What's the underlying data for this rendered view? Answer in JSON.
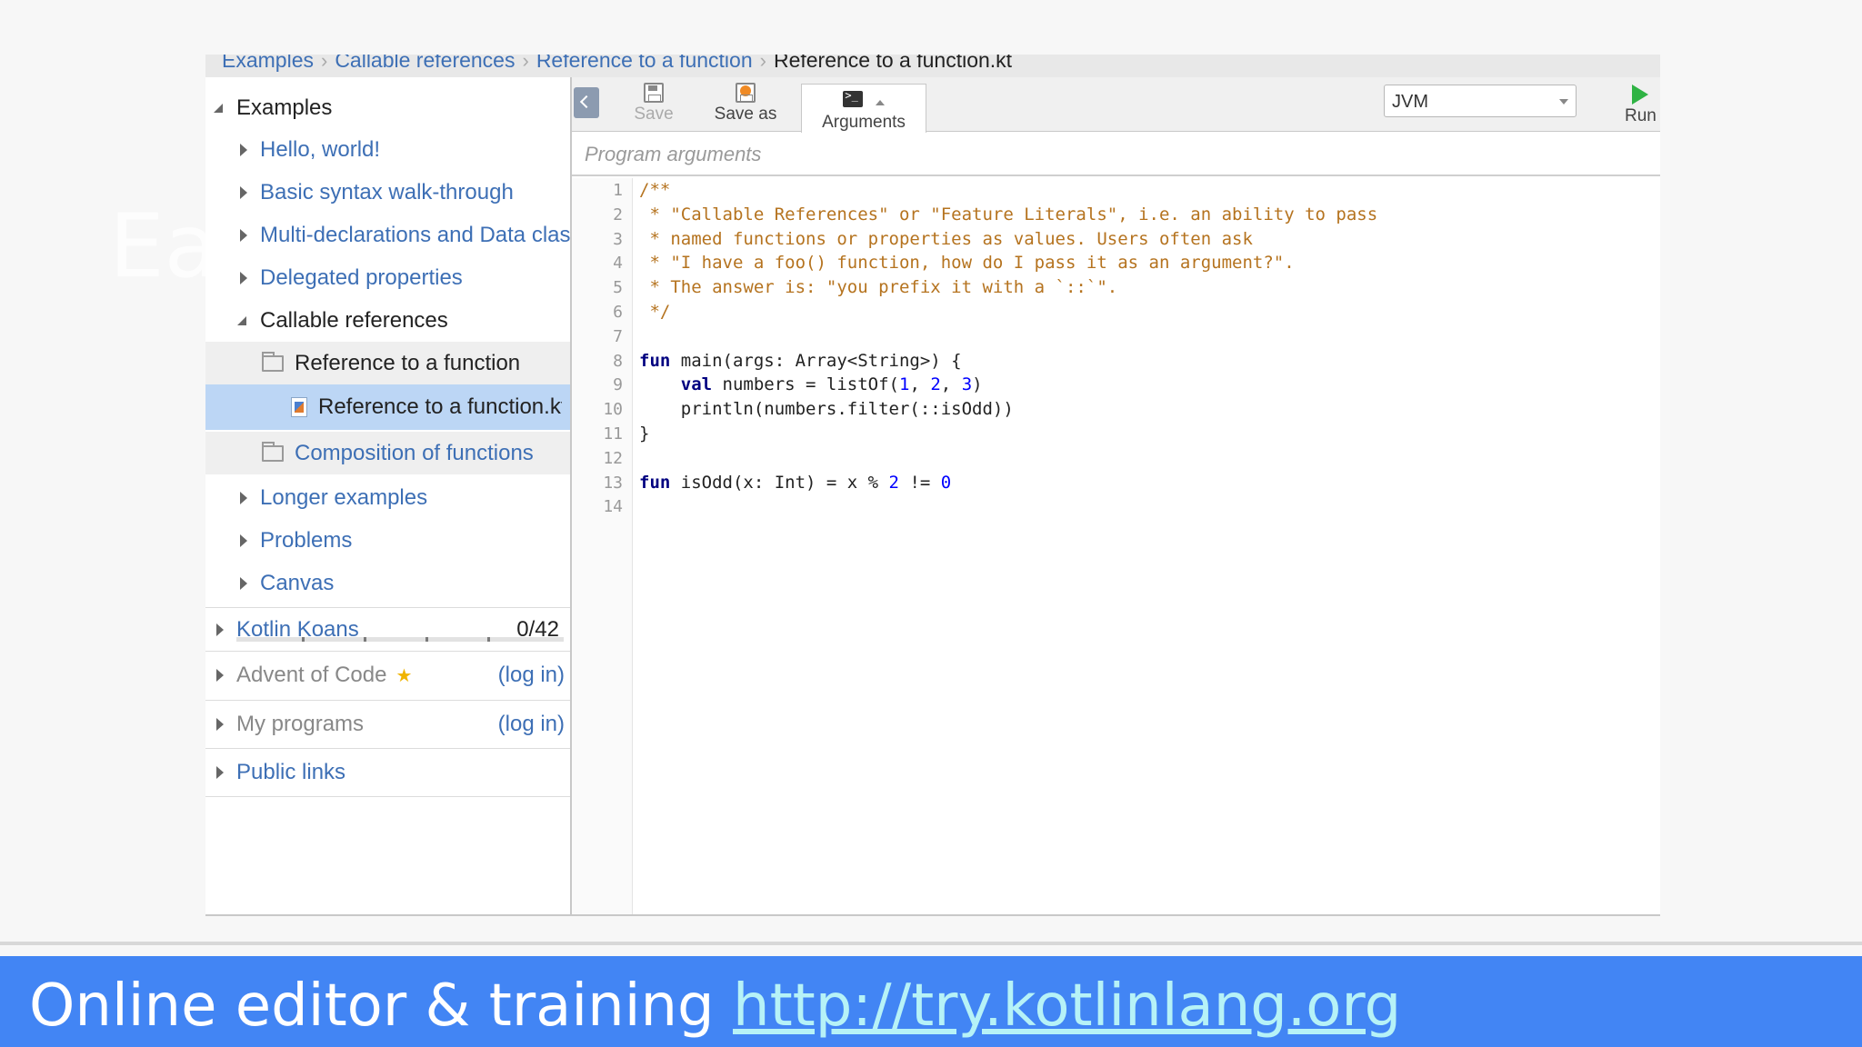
{
  "ghost_text": "Ea",
  "breadcrumb": {
    "items": [
      "Examples",
      "Callable references",
      "Reference to a function"
    ],
    "current": "Reference to a function.kt"
  },
  "sidebar": {
    "examples_label": "Examples",
    "examples_children": [
      {
        "label": "Hello, world!"
      },
      {
        "label": "Basic syntax walk-through"
      },
      {
        "label": "Multi-declarations and Data classes"
      },
      {
        "label": "Delegated properties"
      }
    ],
    "callable": {
      "label": "Callable references",
      "folder1": "Reference to a function",
      "file": "Reference to a function.kt",
      "folder2": "Composition of functions"
    },
    "more_children": [
      {
        "label": "Longer examples"
      },
      {
        "label": "Problems"
      },
      {
        "label": "Canvas"
      }
    ],
    "koans": {
      "label": "Kotlin Koans",
      "count": "0/42",
      "progress": 0
    },
    "advent": {
      "label": "Advent of Code",
      "login": "(log in)"
    },
    "my_programs": {
      "label": "My programs",
      "login": "(log in)"
    },
    "public_links": {
      "label": "Public links"
    }
  },
  "toolbar": {
    "save": "Save",
    "save_as": "Save as",
    "arguments": "Arguments",
    "platform": "JVM",
    "run": "Run"
  },
  "args": {
    "placeholder": "Program arguments"
  },
  "code": {
    "line_numbers": [
      "1",
      "2",
      "3",
      "4",
      "5",
      "6",
      "7",
      "8",
      "9",
      "10",
      "11",
      "12",
      "13",
      "14"
    ],
    "lines": [
      [
        {
          "t": "/**",
          "c": "comment"
        }
      ],
      [
        {
          "t": " * \"Callable References\" or \"Feature Literals\", i.e. an ability to pass",
          "c": "comment"
        }
      ],
      [
        {
          "t": " * named functions or properties as values. Users often ask",
          "c": "comment"
        }
      ],
      [
        {
          "t": " * \"I have a foo() function, how do I pass it as an argument?\".",
          "c": "comment"
        }
      ],
      [
        {
          "t": " * The answer is: \"you prefix it with a `::`\".",
          "c": "comment"
        }
      ],
      [
        {
          "t": " */",
          "c": "comment"
        }
      ],
      [],
      [
        {
          "t": "fun",
          "c": "kw"
        },
        {
          "t": " main(args: Array<String>) {",
          "c": "plain"
        }
      ],
      [
        {
          "t": "    ",
          "c": "plain"
        },
        {
          "t": "val",
          "c": "kw"
        },
        {
          "t": " numbers = listOf(",
          "c": "plain"
        },
        {
          "t": "1",
          "c": "num"
        },
        {
          "t": ", ",
          "c": "plain"
        },
        {
          "t": "2",
          "c": "num"
        },
        {
          "t": ", ",
          "c": "plain"
        },
        {
          "t": "3",
          "c": "num"
        },
        {
          "t": ")",
          "c": "plain"
        }
      ],
      [
        {
          "t": "    println(numbers.filter(::isOdd))",
          "c": "plain"
        }
      ],
      [
        {
          "t": "}",
          "c": "plain"
        }
      ],
      [],
      [
        {
          "t": "fun",
          "c": "kw"
        },
        {
          "t": " isOdd(x: Int) = x % ",
          "c": "plain"
        },
        {
          "t": "2",
          "c": "num"
        },
        {
          "t": " != ",
          "c": "plain"
        },
        {
          "t": "0",
          "c": "num"
        }
      ],
      []
    ]
  },
  "banner": {
    "text": "Online editor & training ",
    "link": "http://try.kotlinlang.org"
  },
  "colors": {
    "banner": "#4285f4",
    "link": "#b6f2f7",
    "selection": "#bcd6f5",
    "comment": "#b5731f",
    "keyword": "#000080",
    "number": "#0000ff"
  }
}
